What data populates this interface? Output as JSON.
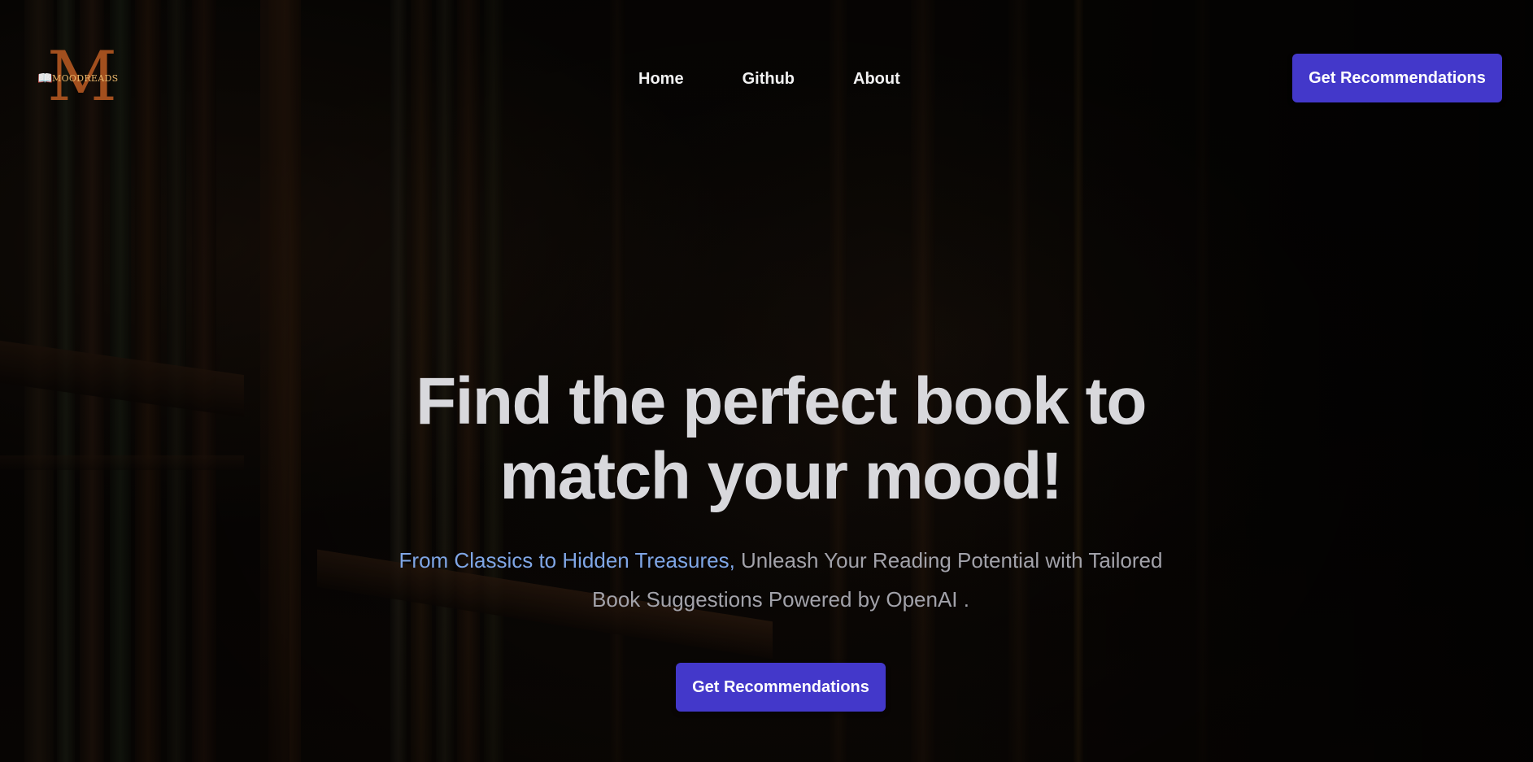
{
  "brand": {
    "logo_letter": "M",
    "logo_text": "MOODREADS",
    "logo_color": "#a24f1e"
  },
  "nav": {
    "items": [
      {
        "label": "Home"
      },
      {
        "label": "Github"
      },
      {
        "label": "About"
      }
    ]
  },
  "header": {
    "cta_label": "Get Recommendations"
  },
  "hero": {
    "title_line1": "Find the perfect book to",
    "title_line2": "match your mood!",
    "subtitle_highlight": "From Classics to Hidden Treasures,",
    "subtitle_rest_1": " Unleash Your Reading Potential with Tailored",
    "subtitle_rest_2": "Book Suggestions Powered by OpenAI .",
    "cta_label": "Get Recommendations"
  },
  "colors": {
    "accent_button": "#4338ca",
    "highlight_text": "#7fa6e6",
    "title_text": "#d8d8dc"
  },
  "icons": {
    "logo_book": "open-book-icon"
  }
}
